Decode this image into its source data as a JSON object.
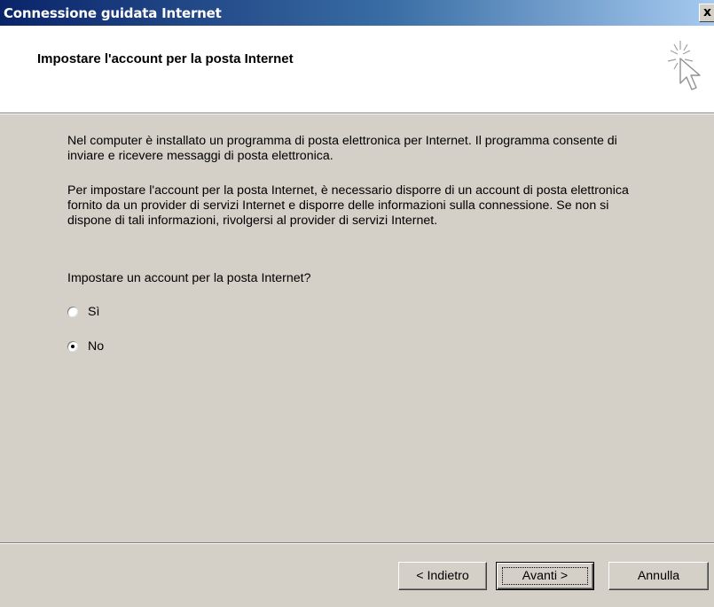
{
  "window": {
    "title": "Connessione guidata Internet",
    "close_label": "x"
  },
  "header": {
    "title": "Impostare l'account per la posta Internet",
    "icon": "wizard-cursor-sparkle-icon"
  },
  "content": {
    "paragraph1": "Nel computer è installato un programma di posta elettronica per Internet. Il programma consente di inviare e ricevere messaggi di posta elettronica.",
    "paragraph2": "Per impostare l'account per la posta Internet, è necessario disporre di un account di posta elettronica fornito da un provider di servizi Internet e disporre delle informazioni sulla connessione. Se non si dispone di tali informazioni, rivolgersi al provider di servizi Internet.",
    "question": "Impostare un account per la posta Internet?",
    "options": [
      {
        "label": "Sì",
        "selected": false
      },
      {
        "label": "No",
        "selected": true
      }
    ]
  },
  "buttons": {
    "back": "< Indietro",
    "next": "Avanti >",
    "cancel": "Annulla"
  },
  "colors": {
    "dialog_bg": "#d4d0c8",
    "title_gradient_start": "#0a246a",
    "title_gradient_end": "#a6caf0",
    "header_bg": "#ffffff"
  }
}
